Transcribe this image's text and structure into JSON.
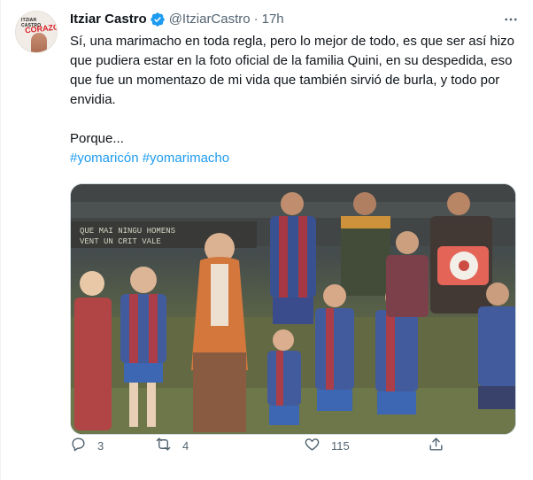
{
  "author": {
    "name": "Itziar Castro",
    "handle": "@ItziarCastro",
    "separator": "·",
    "time": "17h",
    "verified": true,
    "avatar_cover_title": "ITZIAR CASTRO",
    "avatar_cover_heart": "CORAZÓN"
  },
  "tweet": {
    "paragraph1": "Sí, una marimacho en toda regla, pero lo mejor de todo, es que ser así hizo que pudiera estar en la foto oficial de la familia Quini, en su despedida, eso que fue un momentazo  de mi vida que también sirvió de burla, y todo por envidia.",
    "paragraph2": "Porque...",
    "hashtags": [
      "#yomaricón",
      "#yomarimacho"
    ]
  },
  "media": {
    "banner_line1": "QUE MAI NINGU HOMENS",
    "banner_line2": "VENT UN CRIT VALE"
  },
  "actions": {
    "reply_count": "3",
    "retweet_count": "4",
    "like_count": "115"
  },
  "icons": {
    "more": "more-icon",
    "reply": "reply-icon",
    "retweet": "retweet-icon",
    "like": "heart-icon",
    "share": "share-icon"
  },
  "colors": {
    "accent": "#1d9bf0",
    "secondary_text": "#536471",
    "text": "#0f1419"
  }
}
